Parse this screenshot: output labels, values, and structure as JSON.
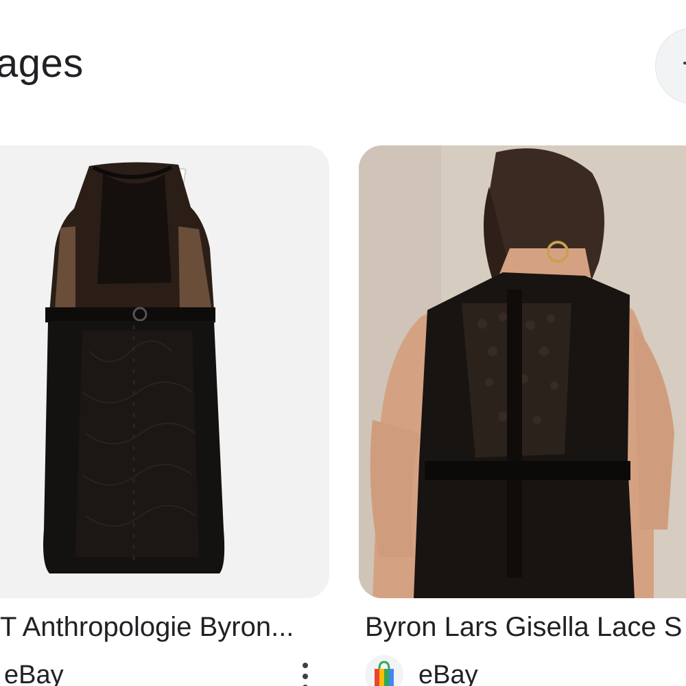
{
  "section": {
    "title": "ages",
    "scroll_icon": "chevron-right-icon"
  },
  "results": [
    {
      "title": "T Anthropologie Byron...",
      "source": "eBay",
      "image_alt": "Black lace sleeveless dress product photo",
      "menu_icon": "more-vert-icon"
    },
    {
      "title": "Byron Lars Gisella Lace S",
      "source": "eBay",
      "image_alt": "Model wearing black lace dress, back view",
      "source_icon": "shopping-bag-icon"
    }
  ],
  "colors": {
    "text": "#202124",
    "card_bg_1": "#f2f2f2",
    "card_bg_2": "#d9cfc3",
    "dress_black": "#141210",
    "lace_brown": "#5a3f2c"
  }
}
